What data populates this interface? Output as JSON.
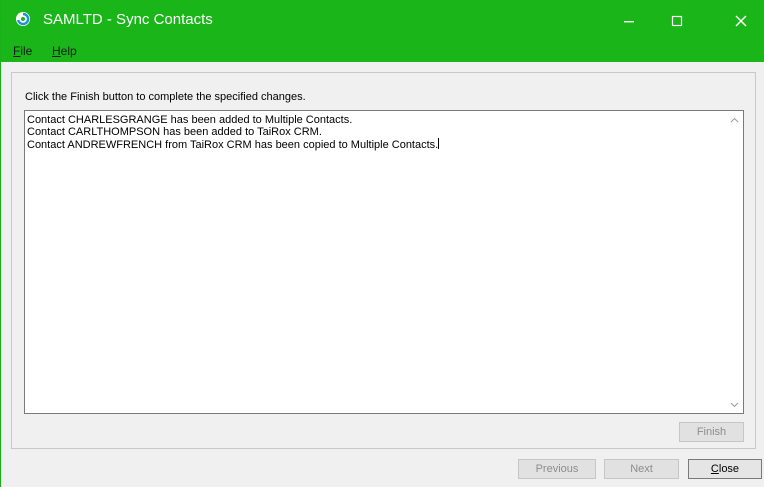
{
  "window": {
    "title": "SAMLTD - Sync Contacts",
    "accent_color": "#19b519",
    "minimize_icon": "minimize-icon",
    "maximize_icon": "maximize-icon",
    "close_icon": "close-icon"
  },
  "menu": {
    "file_first": "F",
    "file_rest": "ile",
    "help_first": "H",
    "help_rest": "elp"
  },
  "main": {
    "instruction": "Click the Finish button to complete the specified changes.",
    "log_lines": [
      "Contact CHARLESGRANGE has been added to Multiple Contacts.",
      "Contact CARLTHOMPSON has been added to TaiRox CRM.",
      "Contact ANDREWFRENCH from TaiRox CRM has been copied to Multiple Contacts."
    ],
    "finish_label": "Finish"
  },
  "footer": {
    "previous_label": "Previous",
    "next_label": "Next",
    "close_first": "C",
    "close_rest": "lose"
  }
}
